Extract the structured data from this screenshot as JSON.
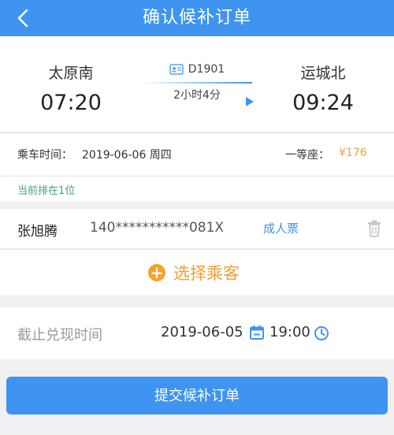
{
  "header": {
    "title": "确认候补订单"
  },
  "train": {
    "from_station": "太原南",
    "from_time": "07:20",
    "to_station": "运城北",
    "to_time": "09:24",
    "train_no": "D1901",
    "duration": "2小时4分"
  },
  "info": {
    "ride_label": "乘车时间：",
    "ride_date": "2019-06-06 周四",
    "seat_label": "一等座：",
    "seat_price": "¥176"
  },
  "queue": {
    "text": "当前排在1位"
  },
  "passenger": {
    "name": "张旭腾",
    "id_number": "140***********081X",
    "ticket_type": "成人票"
  },
  "add_passenger": {
    "label": "选择乘客"
  },
  "deadline": {
    "label": "截止兑现时间",
    "date": "2019-06-05",
    "time": "19:00"
  },
  "submit": {
    "label": "提交候补订单"
  },
  "colors": {
    "accent": "#3e94f0",
    "orange": "#f0a030",
    "green": "#3aa678"
  }
}
